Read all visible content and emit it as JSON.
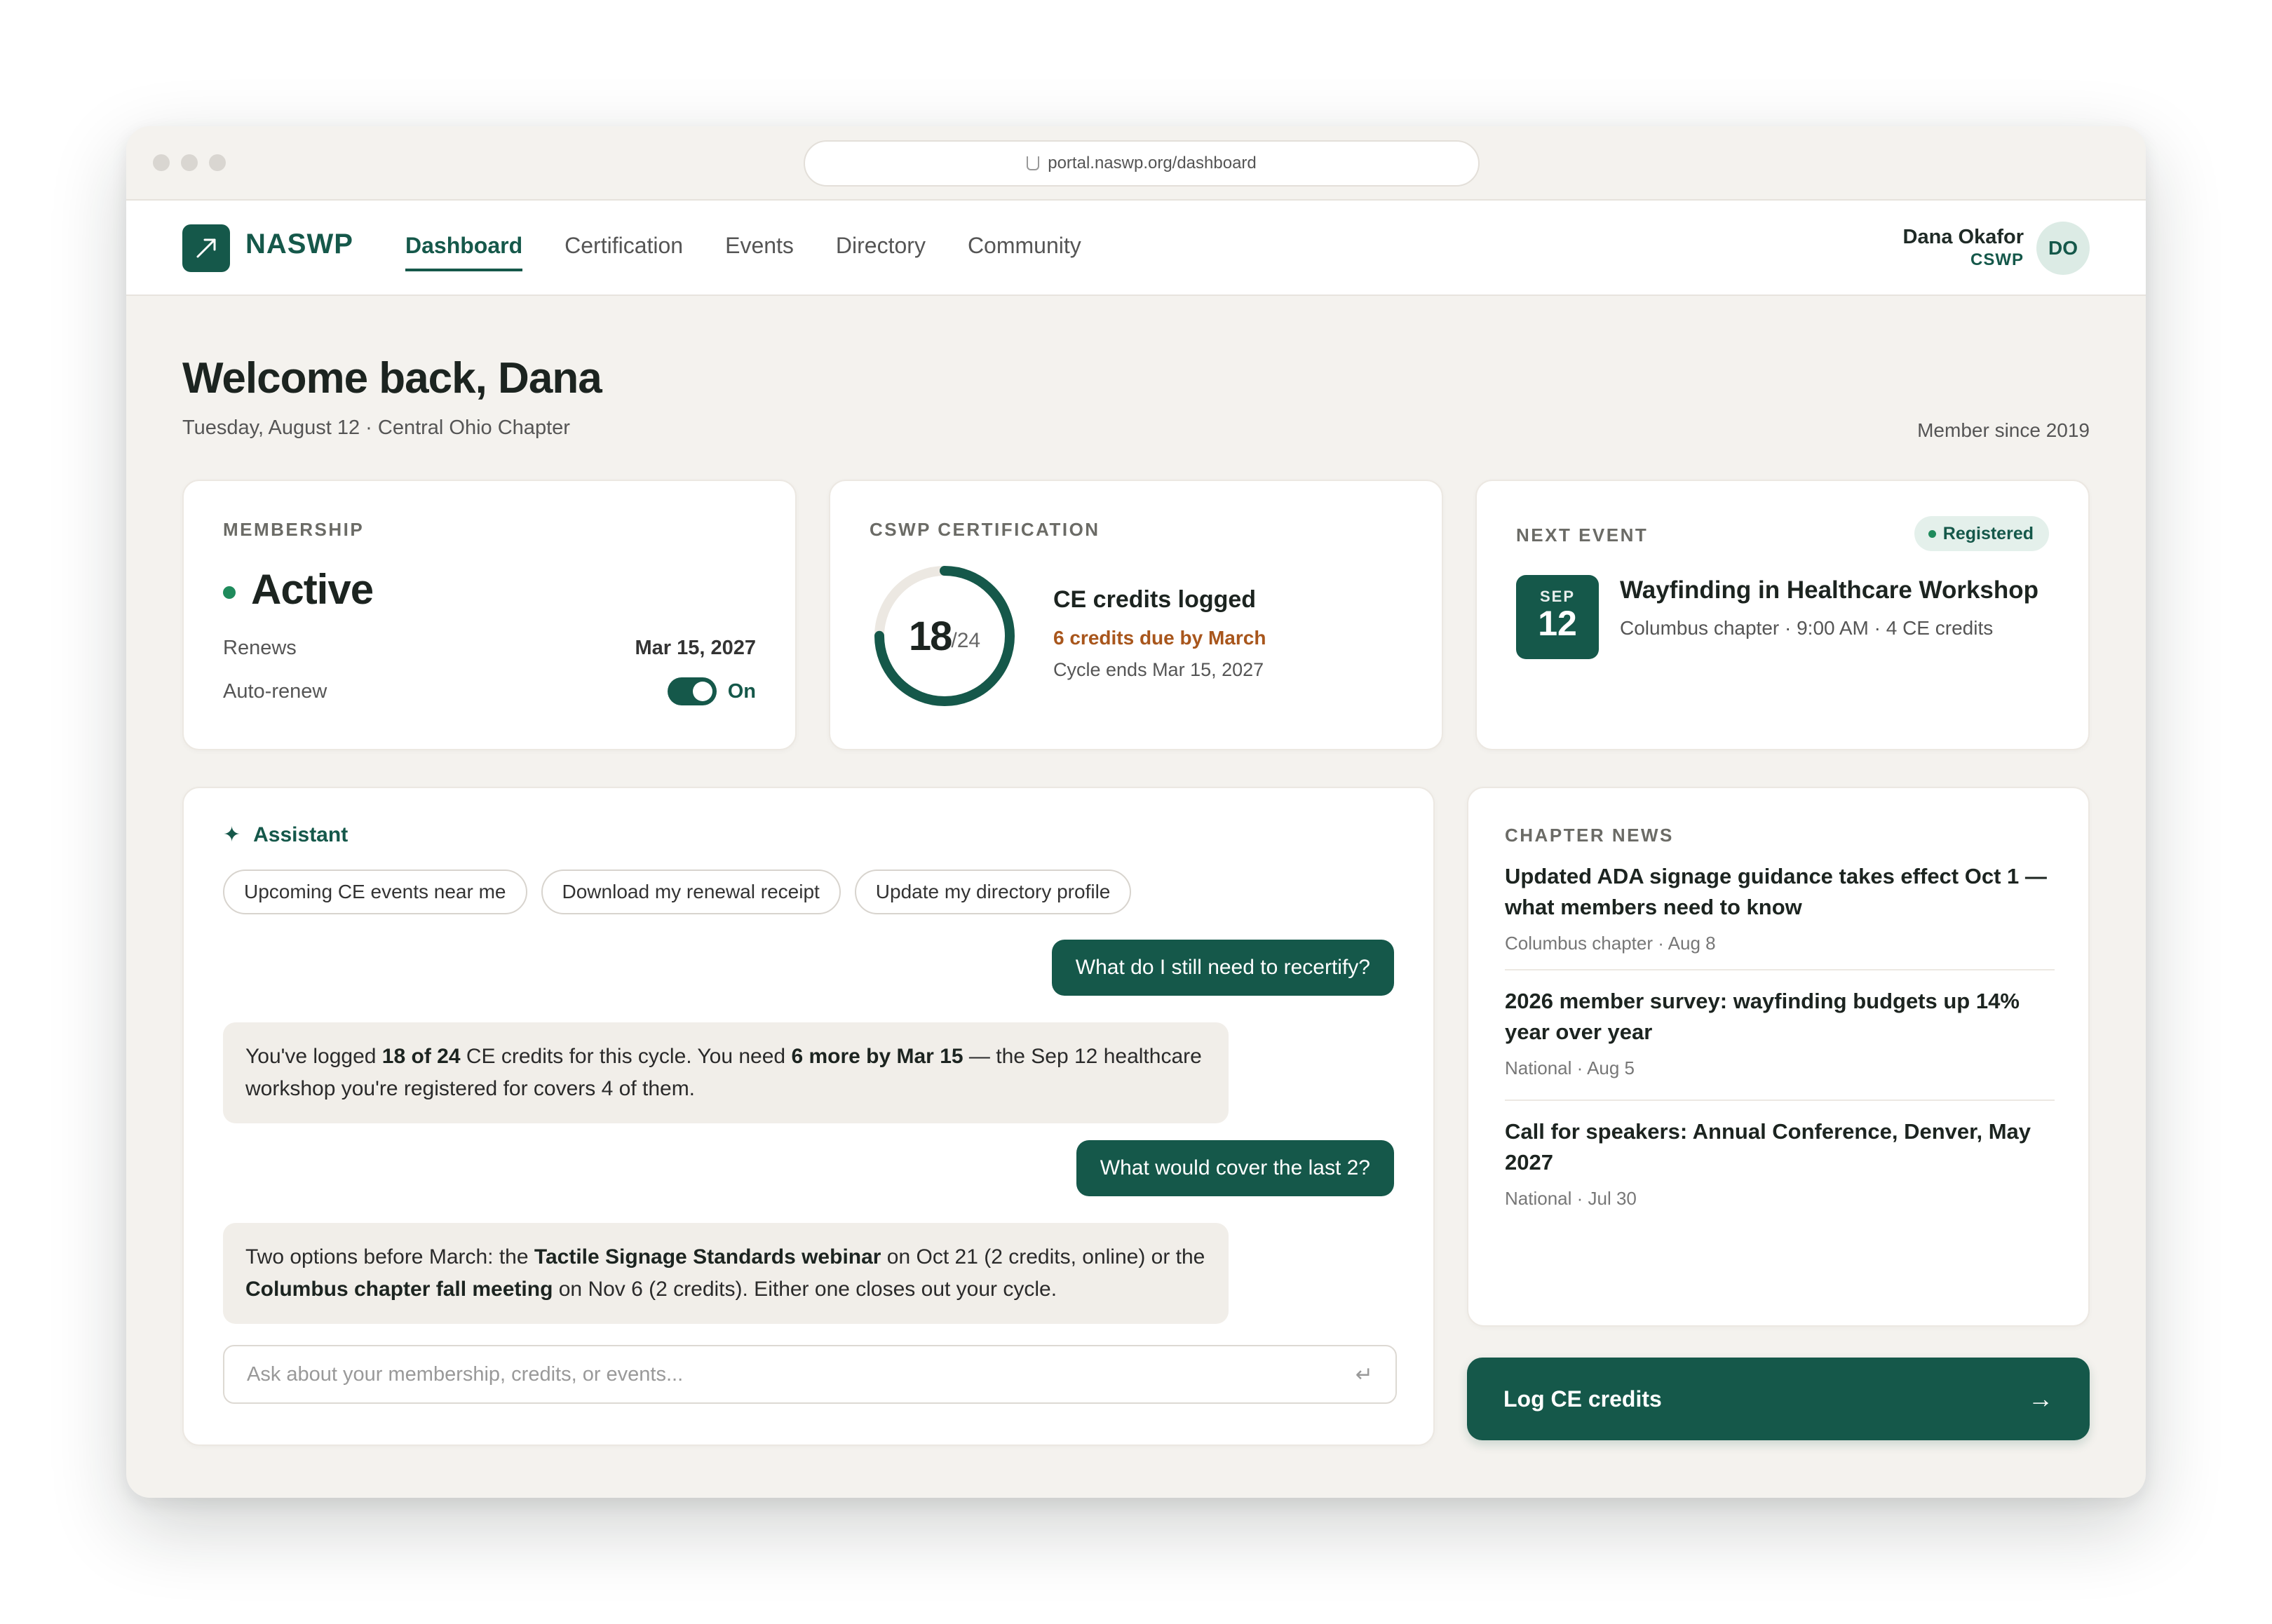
{
  "browser": {
    "url": "portal.naswp.org/dashboard"
  },
  "nav": {
    "brand": "NASWP",
    "tabs": [
      {
        "label": "Dashboard",
        "active": true
      },
      {
        "label": "Certification",
        "active": false
      },
      {
        "label": "Events",
        "active": false
      },
      {
        "label": "Directory",
        "active": false
      },
      {
        "label": "Community",
        "active": false
      }
    ],
    "user": {
      "name": "Dana Okafor",
      "role": "CSWP",
      "initials": "DO"
    }
  },
  "header": {
    "title": "Welcome back, Dana",
    "subtitle": "Tuesday, August 12 · Central Ohio Chapter",
    "member_since": "Member since 2019"
  },
  "membership": {
    "label": "MEMBERSHIP",
    "status": "Active",
    "renews_label": "Renews",
    "renews_value": "Mar 15, 2027",
    "autorenew_label": "Auto-renew",
    "autorenew_value": "On",
    "autorenew_enabled": true
  },
  "certification": {
    "label": "CSWP CERTIFICATION",
    "credits_logged": 18,
    "credits_total": 24,
    "credits_big": "18",
    "credits_small": "/24",
    "title": "CE credits logged",
    "due": "6 credits due by March",
    "cycle": "Cycle ends Mar 15, 2027"
  },
  "next_event": {
    "label": "NEXT EVENT",
    "badge": "Registered",
    "month": "SEP",
    "day": "12",
    "title": "Wayfinding in Healthcare Workshop",
    "meta": "Columbus chapter · 9:00 AM · 4 CE credits"
  },
  "assistant": {
    "title": "Assistant",
    "chips": [
      "Upcoming CE events near me",
      "Download my renewal receipt",
      "Update my directory profile"
    ],
    "messages": {
      "q1": "What do I still need to recertify?",
      "a1": {
        "p1": "You've logged ",
        "b1": "18 of 24",
        "p2": " CE credits for this cycle. You need ",
        "b2": "6 more by Mar 15",
        "p3": " — the Sep 12 healthcare workshop you're registered for covers 4 of them."
      },
      "q2": "What would cover the last 2?",
      "a2": {
        "p1": "Two options before March: the ",
        "b1": "Tactile Signage Standards webinar",
        "p2": " on Oct 21 (2 credits, online) or the ",
        "b2": "Columbus chapter fall meeting",
        "p3": " on Nov 6 (2 credits). Either one closes out your cycle."
      }
    },
    "input_placeholder": "Ask about your membership, credits, or events..."
  },
  "news": {
    "label": "CHAPTER NEWS",
    "items": [
      {
        "title": "Updated ADA signage guidance takes effect Oct 1 — what members need to know",
        "meta": "Columbus chapter · Aug 8"
      },
      {
        "title": "2026 member survey: wayfinding budgets up 14% year over year",
        "meta": "National · Aug 5"
      },
      {
        "title": "Call for speakers: Annual Conference, Denver, May 2027",
        "meta": "National · Jul 30"
      }
    ]
  },
  "cta": {
    "label": "Log CE credits"
  },
  "colors": {
    "brand": "#15584a",
    "accent_warning": "#a8561c",
    "status_active": "#1f8b5c",
    "background": "#f4f2ee"
  }
}
